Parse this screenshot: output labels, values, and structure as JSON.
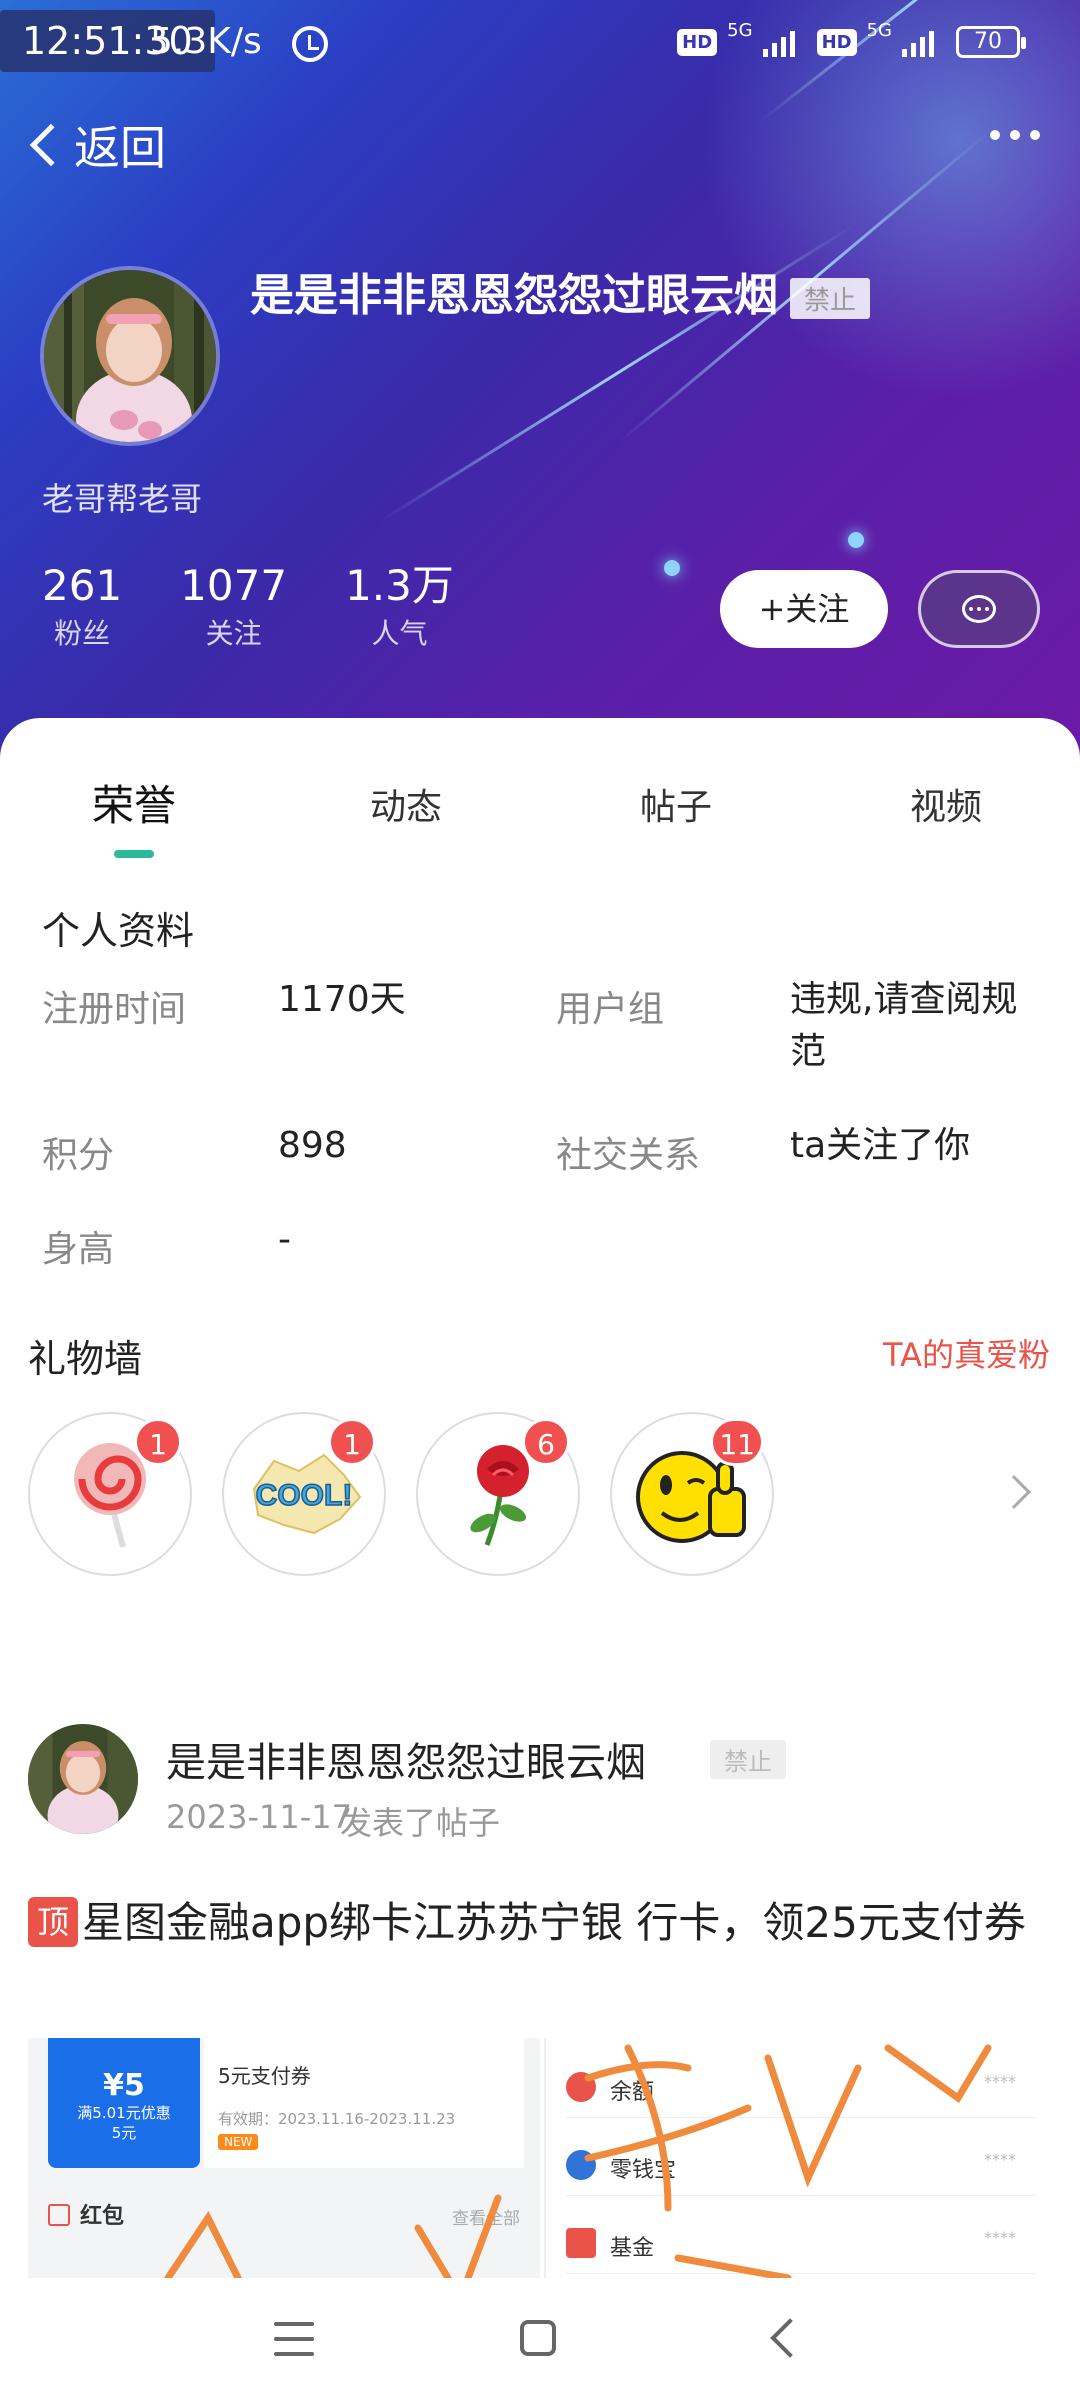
{
  "status_bar": {
    "time": "12:51:30",
    "speed": "5.3K/s",
    "hd1": "HD",
    "net1": "5G",
    "hd2": "HD",
    "net2": "5G",
    "battery": "70"
  },
  "nav": {
    "back_label": "返回"
  },
  "profile": {
    "name": "是是非非恩恩怨怨过眼云烟",
    "ban_badge": "禁止",
    "signature": "老哥帮老哥",
    "stats": [
      {
        "value": "261",
        "label": "粉丝"
      },
      {
        "value": "1077",
        "label": "关注"
      },
      {
        "value": "1.3万",
        "label": "人气"
      }
    ],
    "follow_label": "+关注"
  },
  "tabs": [
    {
      "label": "荣誉",
      "active": true
    },
    {
      "label": "动态",
      "active": false
    },
    {
      "label": "帖子",
      "active": false
    },
    {
      "label": "视频",
      "active": false
    }
  ],
  "info": {
    "title": "个人资料",
    "reg_label": "注册时间",
    "reg_value": "1170天",
    "group_label": "用户组",
    "group_value": "违规,请查阅规范",
    "points_label": "积分",
    "points_value": "898",
    "social_label": "社交关系",
    "social_value": "ta关注了你",
    "height_label": "身高",
    "height_value": "-"
  },
  "gifts": {
    "title": "礼物墙",
    "fans_link": "TA的真爱粉",
    "items": [
      {
        "name": "lollipop",
        "count": "1"
      },
      {
        "name": "cool",
        "count": "1"
      },
      {
        "name": "rose",
        "count": "6"
      },
      {
        "name": "thumbs-up",
        "count": "11"
      }
    ]
  },
  "post": {
    "author": "是是非非恩恩怨怨过眼云烟",
    "ban_badge": "禁止",
    "date": "2023-11-17",
    "action": "发表了帖子",
    "top_tag": "顶",
    "title": "星图金融app绑卡江苏苏宁银 行卡，领25元支付券",
    "image": {
      "coupon_amount": "¥5",
      "coupon_cond": "满5.01元优惠",
      "coupon_cond2": "5元",
      "coupon_title": "5元支付券",
      "coupon_valid": "有效期：2023.11.16-2023.11.23",
      "new_tag": "NEW",
      "redpack": "红包",
      "viewall": "查看全部",
      "rows": [
        {
          "label": "余额",
          "stars": "****"
        },
        {
          "label": "零钱宝",
          "stars": "****"
        },
        {
          "label": "基金",
          "stars": "****"
        }
      ]
    }
  },
  "colors": {
    "accent": "#2bb99a",
    "fans_link": "#e9534a",
    "badge": "#f0504f"
  }
}
